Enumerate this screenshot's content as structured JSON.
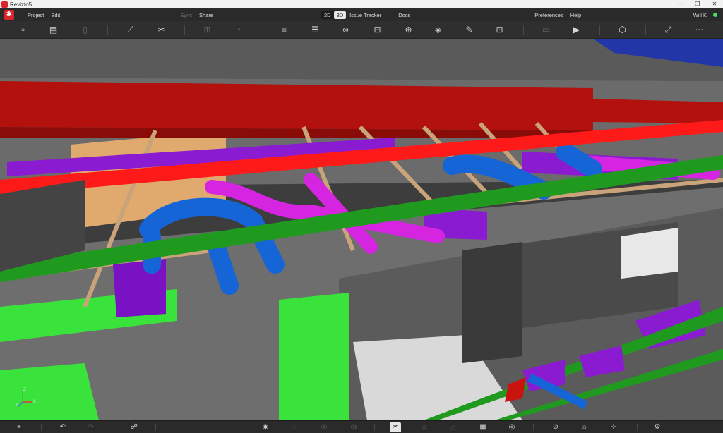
{
  "window": {
    "title": "Revizto5",
    "controls": [
      "—",
      "❐",
      "✕"
    ]
  },
  "menu": {
    "project": "Project",
    "edit": "Edit",
    "sync": "Sync",
    "share": "Share",
    "view_2d": "2D",
    "view_3d": "3D",
    "issue_tracker": "Issue Tracker",
    "docs": "Docs",
    "preferences": "Preferences",
    "help": "Help",
    "user": "Will K",
    "user_status_color": "#4cd964"
  },
  "toolbar": {
    "icons": [
      "location-pin-icon",
      "map-icon",
      "tablet-icon",
      "ruler-icon",
      "scissors-icon",
      "add-issue-icon",
      "issue-counter-icon",
      "layers-icon",
      "list-icon",
      "binoculars-icon",
      "car-icon",
      "clash-icon",
      "paint-bucket-icon",
      "edit-document-icon",
      "document-search-icon",
      "presentation-icon",
      "video-camera-icon",
      "cube-icon",
      "fit-view-icon",
      "more-icon"
    ]
  },
  "bottombar": {
    "icons": [
      "location-pin-icon",
      "undo-icon",
      "redo-icon",
      "walk-mode-icon",
      "eye-icon",
      "hide-icon",
      "isolate-icon",
      "transparency-icon",
      "section-scissors-icon",
      "house-icon",
      "elevation-icon",
      "grid-icon",
      "visibility-icon",
      "no-layer-icon",
      "home-view-icon",
      "focus-icon",
      "settings-icon"
    ],
    "active": "section-scissors-icon"
  },
  "scene": {
    "colors": {
      "beam_red": "#c8130f",
      "pipe_red": "#ff1a1a",
      "duct_purple": "#8a1bd1",
      "pipe_magenta": "#d525e0",
      "pipe_blue": "#1565d6",
      "green_beam": "#1f9a1f",
      "wall_green": "#39e33b",
      "wood": "#c9a37a",
      "concrete": "#7a7a7a"
    },
    "axis_labels": [
      "Z",
      "X",
      "Y"
    ]
  }
}
